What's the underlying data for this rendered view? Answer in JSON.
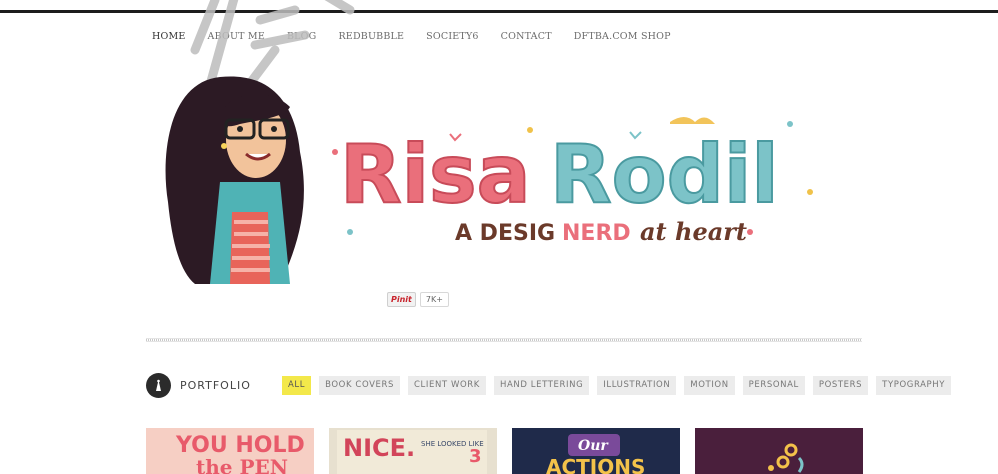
{
  "nav": {
    "items": [
      "HOME",
      "ABOUT ME",
      "BLOG",
      "REDBUBBLE",
      "SOCIETY6",
      "CONTACT",
      "DFTBA.COM SHOP"
    ]
  },
  "header": {
    "logo_main": "RisaRodil",
    "logo_name_first": "Risa",
    "logo_name_last": "Rodil",
    "tagline_a": "A DESIG",
    "tagline_nerd": "NERD",
    "tagline_rest": "at heart"
  },
  "pinit": {
    "label": "Pinit",
    "count": "7K+"
  },
  "portfolio": {
    "title": "PORTFOLIO",
    "filters": [
      "ALL",
      "BOOK COVERS",
      "CLIENT WORK",
      "HAND LETTERING",
      "ILLUSTRATION",
      "MOTION",
      "PERSONAL",
      "POSTERS",
      "TYPOGRAPHY"
    ],
    "active_filter": "ALL",
    "thumbnails": [
      {
        "text_a": "YOU HOLD",
        "text_b": "the PEN",
        "bg": "#f6cfc4"
      },
      {
        "text_a": "NICE.",
        "text_b": "SHE LOOKED LIKE",
        "bg": "#e7e0cf"
      },
      {
        "text_a": "Our",
        "text_b": "ACTIONS",
        "bg": "#1f2a4a"
      },
      {
        "text_a": "",
        "text_b": "",
        "bg": "#4a1f3c"
      }
    ]
  },
  "colors": {
    "accent_yellow": "#f3e84a",
    "logo_pink": "#ea6f7b",
    "logo_teal": "#7cc3c8",
    "tagline_brown": "#6b3a2a"
  }
}
